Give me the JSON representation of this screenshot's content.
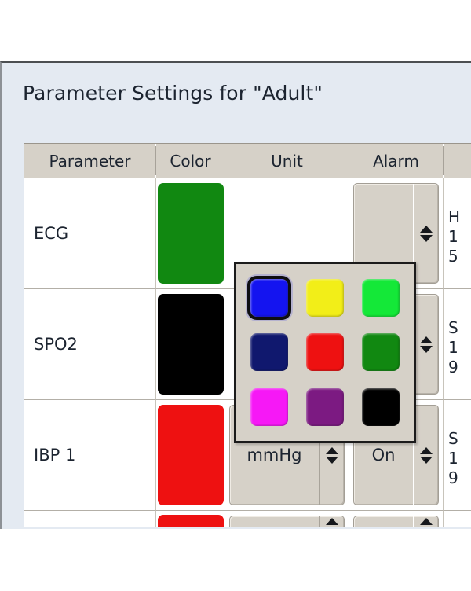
{
  "dialog": {
    "title": "Parameter Settings for \"Adult\""
  },
  "table": {
    "headers": {
      "parameter": "Parameter",
      "color": "Color",
      "unit": "Unit",
      "alarm": "Alarm",
      "limits": ""
    },
    "rows": [
      {
        "parameter": "ECG",
        "color_hex": "#118811",
        "color_name": "green",
        "unit": "",
        "alarm": "",
        "limits": [
          "H",
          "1",
          "5"
        ]
      },
      {
        "parameter": "SPO2",
        "color_hex": "#000000",
        "color_name": "black",
        "unit": "",
        "alarm": "",
        "limits": [
          "S",
          "1",
          "9"
        ]
      },
      {
        "parameter": "IBP 1",
        "color_hex": "#ee1111",
        "color_name": "red",
        "unit": "mmHg",
        "alarm": "On",
        "limits": [
          "S",
          "1",
          "9"
        ]
      },
      {
        "parameter": "",
        "color_hex": "#ee1111",
        "color_name": "red",
        "unit": "",
        "alarm": "",
        "limits": []
      }
    ]
  },
  "color_popup": {
    "selected_index": 0,
    "swatches": [
      {
        "name": "blue",
        "hex": "#1414f0"
      },
      {
        "name": "yellow",
        "hex": "#f2ee18"
      },
      {
        "name": "bright-green",
        "hex": "#14e838"
      },
      {
        "name": "navy",
        "hex": "#10186e"
      },
      {
        "name": "red",
        "hex": "#ee1111"
      },
      {
        "name": "dark-green",
        "hex": "#118811"
      },
      {
        "name": "magenta",
        "hex": "#f618f6"
      },
      {
        "name": "purple",
        "hex": "#7c1a82"
      },
      {
        "name": "black",
        "hex": "#000000"
      }
    ]
  }
}
